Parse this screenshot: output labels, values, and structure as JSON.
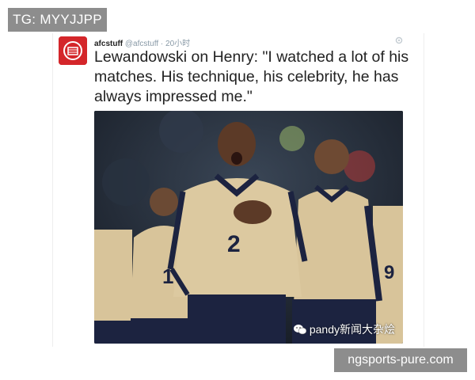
{
  "overlay": {
    "tg_label": "TG: MYYJJPP",
    "site_label": "ngsports-pure.com"
  },
  "tweet": {
    "display_name": "afcstuff",
    "handle": "@afcstuff",
    "separator": "·",
    "time": "20小时",
    "text": "Lewandowski on Henry: \"I watched a lot of his matches. His technique, his celebrity, he has always impressed me.\"",
    "avatar_icon": "arsenal-crest-icon",
    "settings_icon": "gear-icon"
  },
  "photo": {
    "watermark": "pandy新闻大杂烩",
    "watermark_icon": "wechat-icon",
    "shirt_number_center": "2",
    "shirt_number_left": "1",
    "shirt_number_right": "9"
  },
  "colors": {
    "badge_bg": "#8d8d8d",
    "arsenal_red": "#d4262a",
    "jersey_gold": "#d8c49a",
    "jersey_navy": "#1c2340"
  }
}
